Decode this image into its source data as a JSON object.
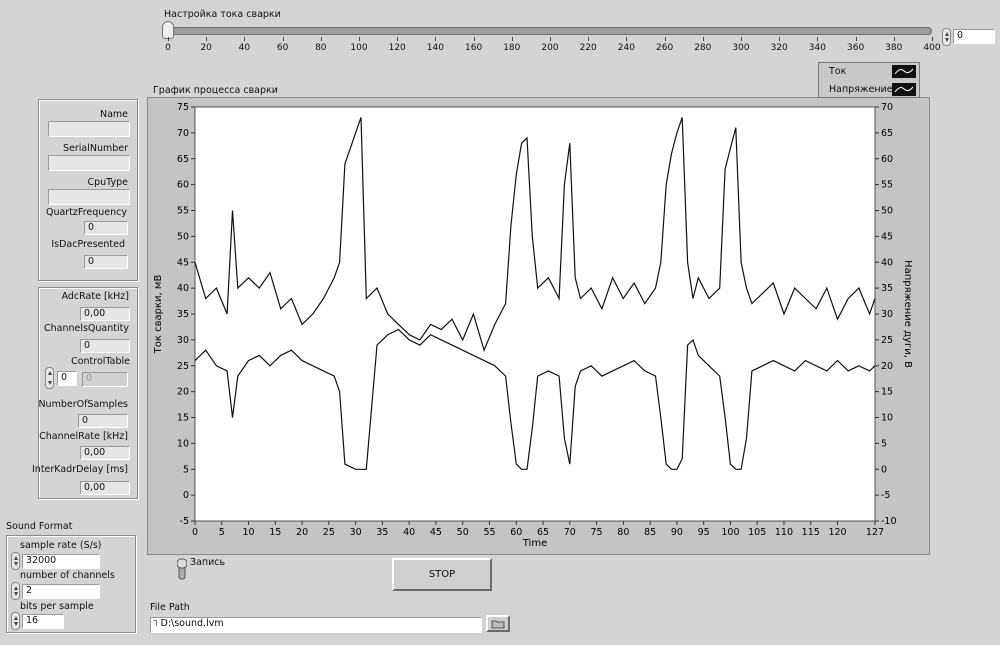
{
  "slider": {
    "label": "Настройка тока сварки",
    "min": 0,
    "max": 400,
    "value": 0,
    "ticks": [
      "0",
      "20",
      "40",
      "60",
      "80",
      "100",
      "120",
      "140",
      "160",
      "180",
      "200",
      "220",
      "240",
      "260",
      "280",
      "300",
      "320",
      "340",
      "360",
      "380",
      "400"
    ],
    "readout": "0"
  },
  "device": {
    "name_label": "Name",
    "name_value": "",
    "serial_label": "SerialNumber",
    "serial_value": "",
    "cputype_label": "CpuType",
    "cputype_value": "",
    "quartz_label": "QuartzFrequency",
    "quartz_value": "0",
    "dac_label": "IsDacPresented",
    "dac_value": "0"
  },
  "adc": {
    "rate_label": "AdcRate [kHz]",
    "rate_value": "0,00",
    "channels_label": "ChannelsQuantity",
    "channels_value": "0",
    "control_label": "ControlTable",
    "control_index": "0",
    "control_value": "0",
    "samples_label": "NumberOfSamples",
    "samples_value": "0",
    "chrate_label": "ChannelRate [kHz]",
    "chrate_value": "0,00",
    "interkadr_label": "InterKadrDelay [ms]",
    "interkadr_value": "0,00"
  },
  "sound": {
    "title": "Sound Format",
    "rate_label": "sample rate (S/s)",
    "rate_value": "32000",
    "channels_label": "number of channels",
    "channels_value": "2",
    "bits_label": "bits per sample",
    "bits_value": "16"
  },
  "controls": {
    "record_label": "Запись",
    "stop_label": "STOP",
    "filepath_label": "File Path",
    "filepath_value": "D:\\sound.lvm"
  },
  "chart_data": {
    "type": "line",
    "title": "График процесса сварки",
    "xlabel": "Time",
    "ylabel_left": "Ток сварки, мВ",
    "ylabel_right": "Напряжение дуги, В",
    "xlim": [
      0,
      127
    ],
    "ylim_left": [
      -5,
      75
    ],
    "ylim_right": [
      -10,
      70
    ],
    "x_ticks": [
      "0",
      "5",
      "10",
      "15",
      "20",
      "25",
      "30",
      "35",
      "40",
      "45",
      "50",
      "55",
      "60",
      "65",
      "70",
      "75",
      "80",
      "85",
      "90",
      "95",
      "100",
      "105",
      "110",
      "115",
      "120",
      "127"
    ],
    "y_left_ticks": [
      "-5",
      "0",
      "5",
      "10",
      "15",
      "20",
      "25",
      "30",
      "35",
      "40",
      "45",
      "50",
      "55",
      "60",
      "65",
      "70",
      "75"
    ],
    "y_right_ticks": [
      "-10",
      "-5",
      "0",
      "5",
      "10",
      "15",
      "20",
      "25",
      "30",
      "35",
      "40",
      "45",
      "50",
      "55",
      "60",
      "65",
      "70"
    ],
    "grid": false,
    "legend_position": "top-right",
    "series": [
      {
        "name": "Ток",
        "axis": "left",
        "x": [
          0,
          2,
          4,
          6,
          7,
          8,
          10,
          12,
          14,
          16,
          18,
          20,
          22,
          24,
          26,
          27,
          28,
          29,
          30,
          31,
          32,
          34,
          36,
          38,
          40,
          42,
          44,
          46,
          48,
          50,
          52,
          54,
          56,
          58,
          59,
          60,
          61,
          62,
          63,
          64,
          66,
          68,
          69,
          70,
          71,
          72,
          74,
          76,
          78,
          80,
          82,
          84,
          86,
          87,
          88,
          89,
          90,
          91,
          92,
          93,
          94,
          96,
          98,
          99,
          100,
          101,
          102,
          103,
          104,
          106,
          108,
          110,
          112,
          114,
          116,
          118,
          120,
          122,
          124,
          126,
          127
        ],
        "values": [
          45,
          38,
          40,
          35,
          55,
          40,
          42,
          40,
          43,
          36,
          38,
          33,
          35,
          38,
          42,
          45,
          64,
          67,
          70,
          73,
          38,
          40,
          35,
          33,
          31,
          30,
          33,
          32,
          34,
          30,
          35,
          28,
          33,
          37,
          52,
          62,
          68,
          69,
          50,
          40,
          42,
          38,
          60,
          68,
          42,
          38,
          40,
          36,
          42,
          38,
          41,
          37,
          40,
          45,
          60,
          66,
          70,
          73,
          45,
          38,
          42,
          38,
          40,
          63,
          67,
          71,
          45,
          40,
          37,
          39,
          41,
          35,
          40,
          38,
          36,
          40,
          34,
          38,
          40,
          35,
          38
        ]
      },
      {
        "name": "Напряжение",
        "axis": "right",
        "x": [
          0,
          2,
          4,
          6,
          7,
          8,
          10,
          12,
          14,
          16,
          18,
          20,
          22,
          24,
          26,
          27,
          28,
          30,
          31,
          32,
          34,
          36,
          38,
          40,
          42,
          44,
          46,
          48,
          50,
          52,
          54,
          56,
          58,
          59,
          60,
          61,
          62,
          63,
          64,
          66,
          68,
          69,
          70,
          71,
          72,
          74,
          76,
          78,
          80,
          82,
          84,
          86,
          87,
          88,
          89,
          90,
          91,
          92,
          93,
          94,
          96,
          98,
          99,
          100,
          101,
          102,
          103,
          104,
          106,
          108,
          110,
          112,
          114,
          116,
          118,
          120,
          122,
          124,
          126,
          127
        ],
        "values": [
          21,
          23,
          20,
          19,
          10,
          18,
          21,
          22,
          20,
          22,
          23,
          21,
          20,
          19,
          18,
          15,
          1,
          0,
          0,
          0,
          24,
          26,
          27,
          25,
          24,
          26,
          25,
          24,
          23,
          22,
          21,
          20,
          18,
          9,
          1,
          0,
          0,
          8,
          18,
          19,
          18,
          6,
          1,
          16,
          19,
          20,
          18,
          19,
          20,
          21,
          19,
          18,
          10,
          1,
          0,
          0,
          2,
          24,
          25,
          22,
          20,
          18,
          10,
          1,
          0,
          0,
          6,
          19,
          20,
          21,
          20,
          19,
          21,
          20,
          19,
          21,
          19,
          20,
          19,
          20
        ]
      }
    ]
  },
  "colors": {
    "background": "#d4d4d4",
    "plot_bg": "#ffffff",
    "trace": "#111111"
  }
}
